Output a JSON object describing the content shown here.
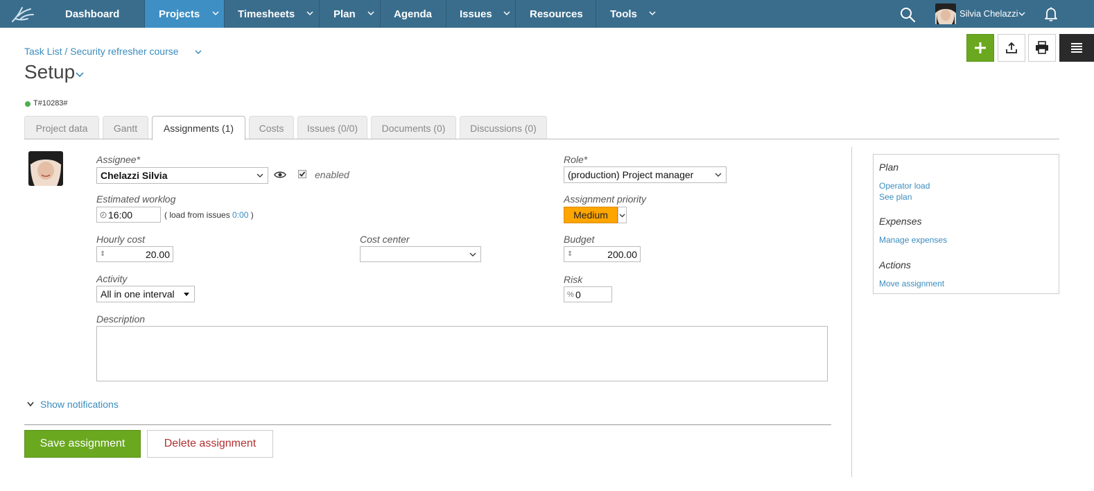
{
  "nav": {
    "items": [
      {
        "label": "Dashboard"
      },
      {
        "label": "Projects"
      },
      {
        "label": "Timesheets"
      },
      {
        "label": "Plan"
      },
      {
        "label": "Agenda"
      },
      {
        "label": "Issues"
      },
      {
        "label": "Resources"
      },
      {
        "label": "Tools"
      }
    ],
    "user_name": "Silvia Chelazzi"
  },
  "header": {
    "breadcrumb": "Task List / Security refresher course",
    "title": "Setup",
    "code": "T#10283#",
    "status_color": "#4caf50"
  },
  "tabs": [
    {
      "label": "Project data"
    },
    {
      "label": "Gantt"
    },
    {
      "label": "Assignments (1)"
    },
    {
      "label": "Costs"
    },
    {
      "label": "Issues (0/0)"
    },
    {
      "label": "Documents (0)"
    },
    {
      "label": "Discussions (0)"
    }
  ],
  "form": {
    "assignee_label": "Assignee*",
    "assignee_value": "Chelazzi Silvia",
    "enabled_label": "enabled",
    "role_label": "Role*",
    "role_value": "(production) Project manager",
    "worklog_label": "Estimated worklog",
    "worklog_value": "16:00",
    "worklog_note_prefix": "( load from issues",
    "worklog_note_link": "0:00",
    "worklog_note_suffix": ")",
    "priority_label": "Assignment priority",
    "priority_value": "Medium",
    "priority_color": "#ffa500",
    "hourly_cost_label": "Hourly cost",
    "hourly_cost_value": "20.00",
    "cost_center_label": "Cost center",
    "cost_center_value": "",
    "budget_label": "Budget",
    "budget_value": "200.00",
    "activity_label": "Activity",
    "activity_value": "All in one interval",
    "risk_label": "Risk",
    "risk_prefix": "%",
    "risk_value": "0",
    "description_label": "Description",
    "description_value": ""
  },
  "footer": {
    "show_notifications": "Show notifications",
    "save_label": "Save assignment",
    "delete_label": "Delete assignment"
  },
  "side": {
    "plan_title": "Plan",
    "operator_load": "Operator load",
    "see_plan": "See plan",
    "expenses_title": "Expenses",
    "manage_expenses": "Manage expenses",
    "actions_title": "Actions",
    "move_assignment": "Move assignment"
  },
  "colors": {
    "nav_bg": "#3a6d8c",
    "nav_active": "#3e8fc4",
    "accent_green": "#6aa820",
    "link": "#3a8bbd"
  }
}
